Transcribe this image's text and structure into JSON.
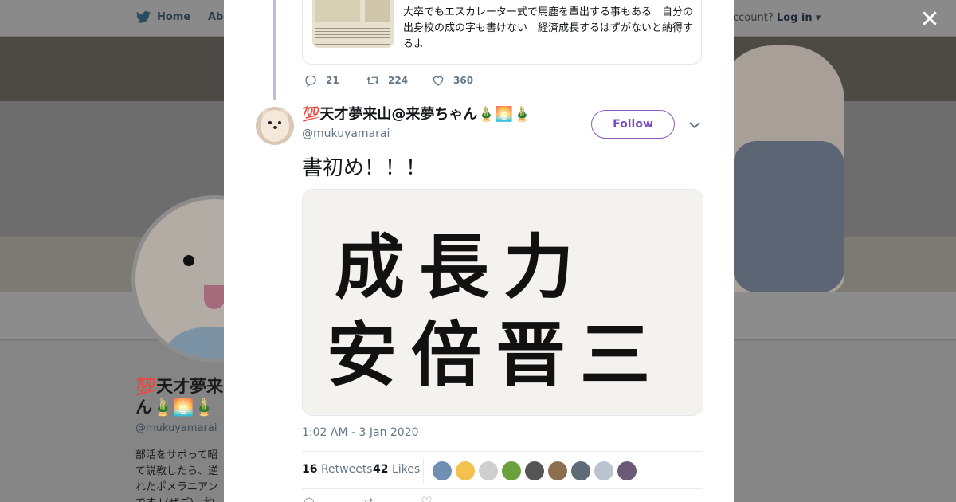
{
  "background": {
    "nav": {
      "home": "Home",
      "about": "Abo",
      "login_prompt": "ccount?",
      "login": "Log in"
    },
    "profile": {
      "name_line1": "💯天才夢来",
      "name_line2": "ん🎍🌅🎍",
      "handle": "@mukuyamarai",
      "bio_lines": [
        "部活をサボって昭",
        "て説教したら、逆",
        "れたポメラニアン",
        "です↓(ぜご)…約"
      ]
    }
  },
  "previous_tweet": {
    "card_text_cut": "……",
    "card_text": "大卒でもエスカレーター式で馬鹿を輩出する事もある　自分の出身校の成の字も書けない　経済成長するはずがないと納得するよ",
    "replies": "21",
    "retweets": "224",
    "likes": "360"
  },
  "tweet": {
    "display_name": "💯天才夢来山@来夢ちゃん🎍🌅🎍",
    "username": "@mukuyamarai",
    "follow_label": "Follow",
    "text": "書初め！！！",
    "image_text_line1": "成長力",
    "image_text_line2": "安倍晋三",
    "timestamp": "1:02 AM - 3 Jan 2020",
    "retweets_count": "16",
    "retweets_label": "Retweets",
    "likes_count": "42",
    "likes_label": "Likes",
    "liker_colors": [
      "#6f8fb5",
      "#f2c14e",
      "#cfcfcf",
      "#6aa13c",
      "#555555",
      "#8b6f4e",
      "#5c6b75",
      "#b9c4cf",
      "#6b5a75"
    ]
  },
  "colors": {
    "accent": "#794bc4",
    "thread": "#c7b5dd",
    "muted": "#657786"
  },
  "icons": {
    "close": "close-icon",
    "reply": "reply-icon",
    "retweet": "retweet-icon",
    "like": "heart-icon",
    "caret": "chevron-down-icon"
  }
}
